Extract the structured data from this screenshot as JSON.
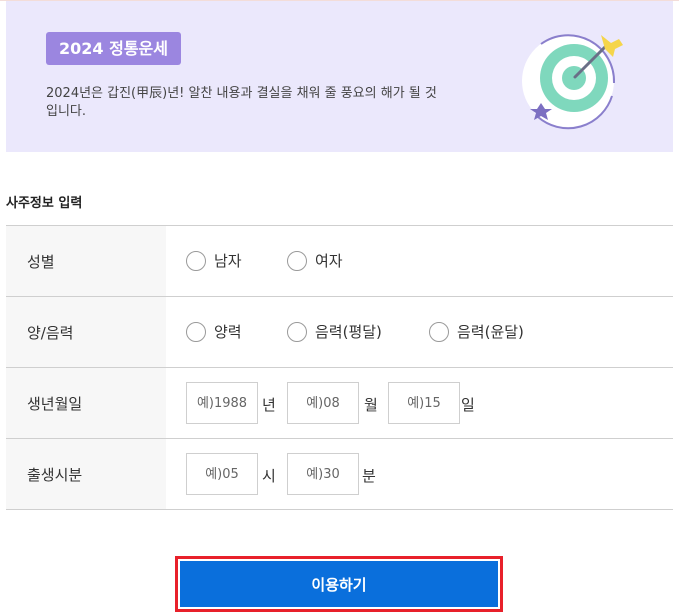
{
  "banner": {
    "badge": "2024 정통운세",
    "description": "2024년은 갑진(甲辰)년! 알찬 내용과 결실을 채워 줄 풍요의 해가 될 것입니다."
  },
  "form": {
    "section_title": "사주정보 입력",
    "gender": {
      "label": "성별",
      "options": [
        "남자",
        "여자"
      ]
    },
    "calendar": {
      "label": "양/음력",
      "options": [
        "양력",
        "음력(평달)",
        "음력(윤달)"
      ]
    },
    "birthdate": {
      "label": "생년월일",
      "year_placeholder": "예)1988",
      "year_unit": "년",
      "month_placeholder": "예)08",
      "month_unit": "월",
      "day_placeholder": "예)15",
      "day_unit": "일"
    },
    "birthtime": {
      "label": "출생시분",
      "hour_placeholder": "예)05",
      "hour_unit": "시",
      "minute_placeholder": "예)30",
      "minute_unit": "분"
    }
  },
  "submit_label": "이용하기",
  "colors": {
    "banner_bg": "#ebe8fc",
    "badge_bg": "#9b86e0",
    "button_bg": "#0a6fdc",
    "highlight_border": "#e8202a"
  }
}
